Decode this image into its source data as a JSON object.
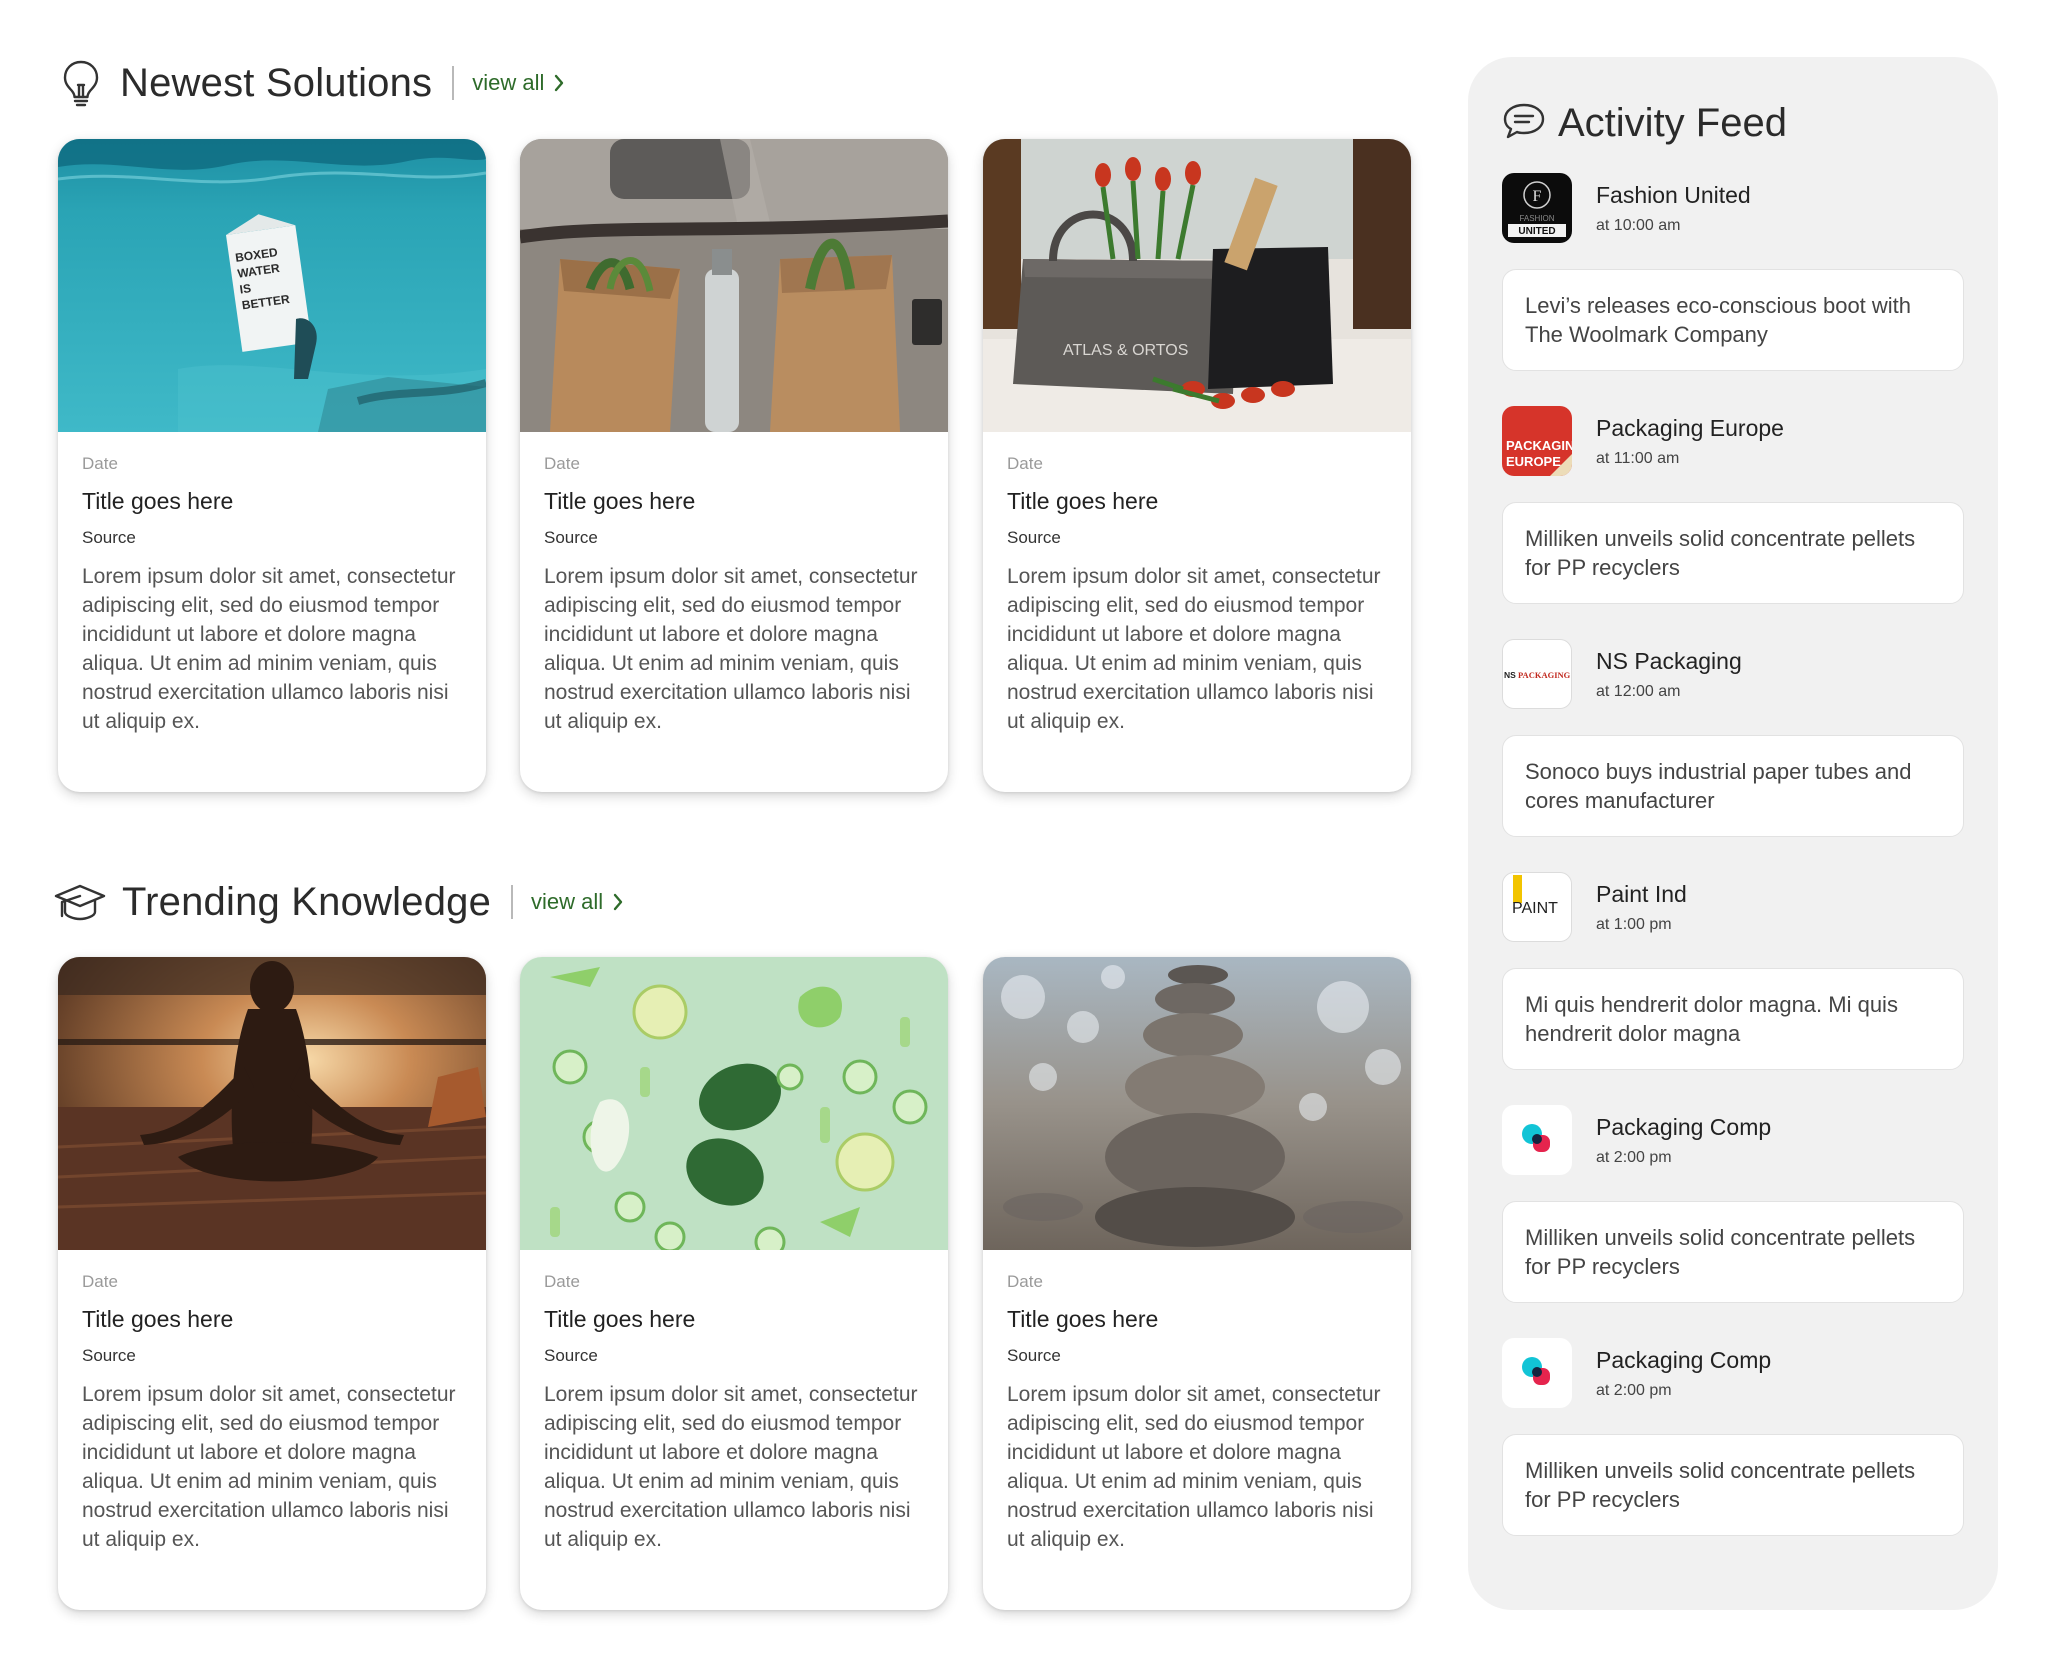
{
  "sections": {
    "newest": {
      "title": "Newest Solutions",
      "view_all": "view all"
    },
    "trending": {
      "title": "Trending Knowledge",
      "view_all": "view all"
    }
  },
  "card_text": {
    "date": "Date",
    "title": "Title goes here",
    "source": "Source",
    "description": "Lorem ipsum dolor sit amet, consectetur adipiscing elit, sed do eiusmod tempor incididunt ut labore et dolore magna aliqua. Ut enim ad minim veniam, quis nostrud exercitation ullamco laboris nisi ut aliquip ex."
  },
  "newest_cards": [
    {
      "date": "Date",
      "title": "Title goes here",
      "source": "Source",
      "image": "boxed-water-underwater"
    },
    {
      "date": "Date",
      "title": "Title goes here",
      "source": "Source",
      "image": "paper-bags-on-bicycle"
    },
    {
      "date": "Date",
      "title": "Title goes here",
      "source": "Source",
      "image": "tote-bag-with-flowers"
    }
  ],
  "trending_cards": [
    {
      "date": "Date",
      "title": "Title goes here",
      "source": "Source",
      "image": "meditation-sunset"
    },
    {
      "date": "Date",
      "title": "Title goes here",
      "source": "Source",
      "image": "green-vegetables-flatlay"
    },
    {
      "date": "Date",
      "title": "Title goes here",
      "source": "Source",
      "image": "stacked-stones"
    }
  ],
  "image_lettering": {
    "boxed_water": [
      "BOXED",
      "WATER",
      "IS",
      "BETTER"
    ],
    "tote_bag": "ATLAS & ORTOS"
  },
  "activity_feed": {
    "title": "Activity Feed",
    "entries": [
      {
        "source": "Fashion United",
        "time": "at 10:00 am",
        "message": "Levi’s releases eco-conscious boot with The Woolmark Company",
        "logo": "fashion-united-logo",
        "logo_text": [
          "F",
          "FASHION",
          "UNITED"
        ]
      },
      {
        "source": "Packaging Europe",
        "time": "at 11:00 am",
        "message": "Milliken unveils solid concentrate pellets for PP recyclers",
        "logo": "packaging-europe-logo",
        "logo_text": [
          "PACKAGING",
          "EUROPE"
        ]
      },
      {
        "source": "NS Packaging",
        "time": "at 12:00 am",
        "message": "Sonoco buys industrial paper tubes and cores manufacturer",
        "logo": "ns-packaging-logo",
        "logo_text": [
          "NS",
          "PACKAGING"
        ]
      },
      {
        "source": "Paint Ind",
        "time": "at 1:00 pm",
        "message": "Mi quis hendrerit dolor magna. Mi quis hendrerit dolor magna",
        "logo": "paint-ind-logo",
        "logo_text": [
          "PAINT"
        ]
      },
      {
        "source": "Packaging Comp",
        "time": "at 2:00 pm",
        "message": "Milliken unveils solid concentrate pellets for PP recyclers",
        "logo": "packaging-comp-logo"
      },
      {
        "source": "Packaging Comp",
        "time": "at 2:00 pm",
        "message": "Milliken unveils solid concentrate pellets for PP recyclers",
        "logo": "packaging-comp-logo"
      }
    ]
  },
  "colors": {
    "link_green": "#2e6b2a",
    "feed_background": "#f1f1f1",
    "card_background": "#ffffff"
  },
  "icons": {
    "newest": "lightbulb-icon",
    "trending": "graduation-cap-icon",
    "feed": "chat-bubble-icon",
    "view_all": "chevron-right-icon"
  }
}
